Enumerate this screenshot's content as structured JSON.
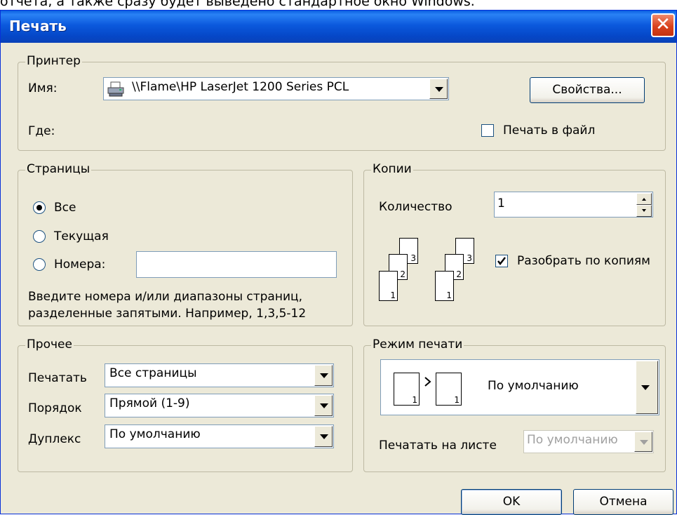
{
  "top_text": "отчета, а также сразу будет выведено стандартное окно Windows.",
  "window": {
    "title": "Печать",
    "close_glyph": "✕"
  },
  "printer": {
    "legend": "Принтер",
    "name_label": "Имя:",
    "name_value": "\\\\Flame\\HP LaserJet 1200 Series PCL",
    "where_label": "Где:",
    "properties_button": "Свойства...",
    "print_to_file_label": "Печать в файл",
    "print_to_file_checked": false,
    "icon": "printer-icon"
  },
  "pages": {
    "legend": "Страницы",
    "options": [
      {
        "label": "Все",
        "selected": true
      },
      {
        "label": "Текущая",
        "selected": false
      },
      {
        "label": "Номера:",
        "selected": false
      }
    ],
    "numbers_value": "",
    "hint_line1": "Введите номера и/или диапазоны страниц,",
    "hint_line2": "разделенные запятыми. Например, 1,3,5-12"
  },
  "copies": {
    "legend": "Копии",
    "count_label": "Количество",
    "count_value": "1",
    "collate_label": "Разобрать по копиям",
    "collate_checked": true,
    "page_numbers": [
      "1",
      "2",
      "3"
    ]
  },
  "other": {
    "legend": "Прочее",
    "print_label": "Печатать",
    "print_value": "Все страницы",
    "order_label": "Порядок",
    "order_value": "Прямой (1-9)",
    "duplex_label": "Дуплекс",
    "duplex_value": "По умолчанию"
  },
  "mode": {
    "legend": "Режим печати",
    "mode_value": "По умолчанию",
    "sheet_label": "Печатать на листе",
    "sheet_value": "По умолчанию",
    "page_numbers": [
      "1",
      "1"
    ]
  },
  "buttons": {
    "ok": "OK",
    "cancel": "Отмена"
  },
  "colors": {
    "titlebar": "#0a5ee0",
    "dialog_bg": "#ece9d8",
    "close": "#d9431e"
  }
}
